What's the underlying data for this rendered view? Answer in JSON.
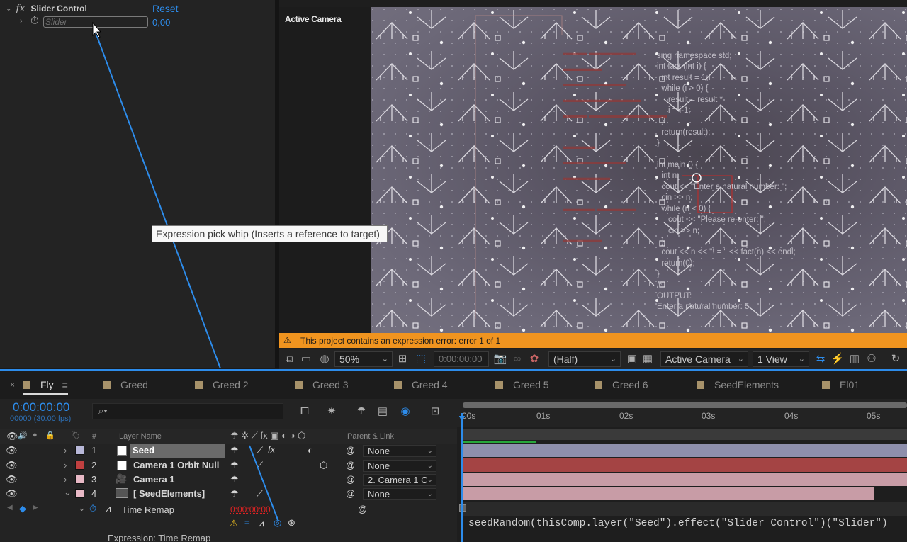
{
  "effect_controls": {
    "effect_name": "Slider Control",
    "reset_label": "Reset",
    "slider_label": "Slider",
    "slider_value": "0,00"
  },
  "tooltip": "Expression pick whip (Inserts a reference to target)",
  "viewer": {
    "camera_label": "Active Camera",
    "error_message": "This project contains an expression error: error 1 of 1",
    "code_text": "sing namespace std;\nint fact (int i) {\n  int result = 1;\n  while (i > 0) {\n     result = result *\n     i = i-1;\n  }\n  return(result);\n}\n\nint main () {\n  int n;\n  cout << \"Enter a natural number: \";\n  cin >> n;\n  while (n < 0) {\n     cout << \"Please re-enter: \";\n     cin >> n;\n  }\n  cout << n << \"! = \" << fact(n) << endl;\n  return(0);\n}\n/*\nOUTPUT:\nEnter a natural number: 5",
    "toolbar": {
      "zoom": "50%",
      "timecode": "0:00:00:00",
      "resolution": "(Half)",
      "camera": "Active Camera",
      "views": "1 View"
    },
    "accent_color": "#f0941f"
  },
  "timeline": {
    "tabs": [
      {
        "label": "Fly"
      },
      {
        "label": "Greed"
      },
      {
        "label": "Greed 2"
      },
      {
        "label": "Greed 3"
      },
      {
        "label": "Greed 4"
      },
      {
        "label": "Greed 5"
      },
      {
        "label": "Greed 6"
      },
      {
        "label": "SeedElements"
      },
      {
        "label": "El01"
      }
    ],
    "current_time": "0:00:00:00",
    "fps_label": "00000 (30.00 fps)",
    "headers": {
      "number": "#",
      "layer_name": "Layer Name",
      "parent_link": "Parent & Link"
    },
    "layers": [
      {
        "num": "1",
        "name": "Seed",
        "label_color": "#b8b8d8",
        "parent": "None"
      },
      {
        "num": "2",
        "name": "Camera 1 Orbit Null",
        "label_color": "#c04040",
        "parent": "None"
      },
      {
        "num": "3",
        "name": "Camera 1",
        "label_color": "#e8b9c6",
        "parent": "2. Camera 1 C"
      },
      {
        "num": "4",
        "name": "[ SeedElements]",
        "label_color": "#e8b9c6",
        "parent": "None"
      }
    ],
    "time_remap": {
      "label": "Time Remap",
      "value": "0:00:00:00"
    },
    "expression_label": "Expression: Time Remap",
    "expression_code": "seedRandom(thisComp.layer(\"Seed\").effect(\"Slider Control\")(\"Slider\")",
    "ruler_ticks": [
      "00s",
      "01s",
      "02s",
      "03s",
      "04s",
      "05s"
    ],
    "bar_colors": [
      "#8e8fac",
      "#a44444",
      "#c89ca6",
      "#c89ca6"
    ]
  }
}
